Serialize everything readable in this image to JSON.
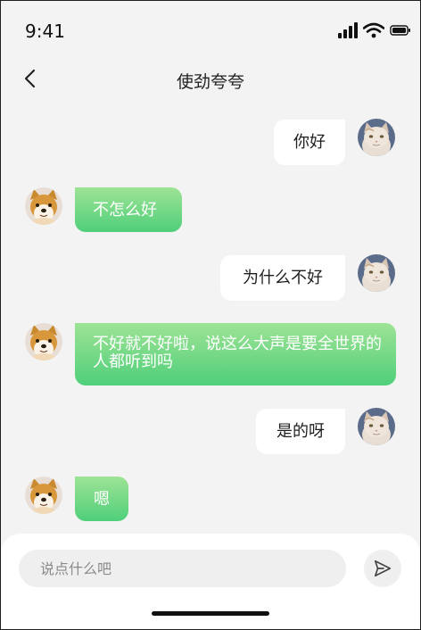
{
  "status_bar": {
    "time": "9:41"
  },
  "header": {
    "title": "使劲夸夸"
  },
  "messages": [
    {
      "direction": "out",
      "text": "你好",
      "avatar": "cat-avatar"
    },
    {
      "direction": "in",
      "text": "不怎么好",
      "avatar": "shiba-avatar"
    },
    {
      "direction": "out",
      "text": "为什么不好",
      "avatar": "cat-avatar"
    },
    {
      "direction": "in",
      "text": "不好就不好啦，说这么大声是要全世界的人都听到吗",
      "avatar": "shiba-avatar"
    },
    {
      "direction": "out",
      "text": "是的呀",
      "avatar": "cat-avatar"
    },
    {
      "direction": "in",
      "text": "嗯",
      "avatar": "shiba-avatar"
    }
  ],
  "composer": {
    "placeholder": "说点什么吧",
    "value": ""
  },
  "icons": {
    "back": "chevron-left-icon",
    "send": "send-icon",
    "signal": "signal-icon",
    "wifi": "wifi-icon",
    "battery": "battery-icon"
  },
  "colors": {
    "background": "#f3f3f3",
    "incoming_bubble_top": "#9ee395",
    "incoming_bubble_bottom": "#4fcf7a",
    "outgoing_bubble": "#ffffff"
  }
}
